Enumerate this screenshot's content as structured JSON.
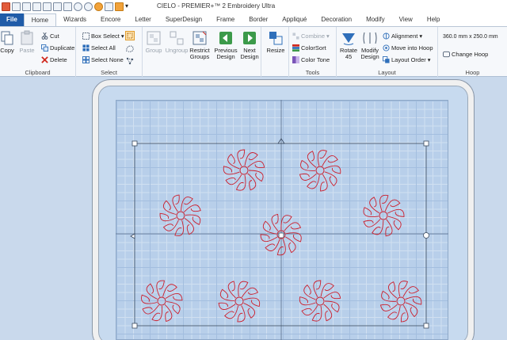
{
  "window": {
    "title": "CIELO - PREMIER+™ 2 Embroidery Ultra"
  },
  "tabs": [
    {
      "label": "File"
    },
    {
      "label": "Home"
    },
    {
      "label": "Wizards"
    },
    {
      "label": "Encore"
    },
    {
      "label": "Letter"
    },
    {
      "label": "SuperDesign"
    },
    {
      "label": "Frame"
    },
    {
      "label": "Border"
    },
    {
      "label": "Appliqué"
    },
    {
      "label": "Decoration"
    },
    {
      "label": "Modify"
    },
    {
      "label": "View"
    },
    {
      "label": "Help"
    }
  ],
  "ribbon": {
    "clipboard": {
      "label": "Clipboard",
      "copy": "Copy",
      "paste": "Paste",
      "cut": "Cut",
      "duplicate": "Duplicate",
      "delete": "Delete"
    },
    "select": {
      "label": "Select",
      "box_select": "Box Select",
      "select_all": "Select All",
      "select_none": "Select None",
      "group": "Group",
      "ungroup": "Ungroup",
      "restrict_groups_1": "Restrict",
      "restrict_groups_2": "Groups",
      "previous_design_1": "Previous",
      "previous_design_2": "Design",
      "next_design_1": "Next",
      "next_design_2": "Design"
    },
    "resize": {
      "label": "Resize"
    },
    "tools": {
      "label": "Tools",
      "combine": "Combine",
      "colorsort": "ColorSort",
      "color_tone": "Color Tone"
    },
    "layout": {
      "label": "Layout",
      "rotate_1": "Rotate",
      "rotate_2": "45",
      "modify_design_1": "Modify",
      "modify_design_2": "Design",
      "alignment": "Alignment",
      "move_into_hoop": "Move into Hoop",
      "layout_order": "Layout Order"
    },
    "hoop": {
      "label": "Hoop",
      "size": "360.0 mm x 250.0 mm",
      "change_hoop": "Change Hoop"
    }
  },
  "colors": {
    "stitch": "#cc1f2d",
    "accent": "#1f5ba8",
    "grid_bg": "#b8cfea"
  }
}
